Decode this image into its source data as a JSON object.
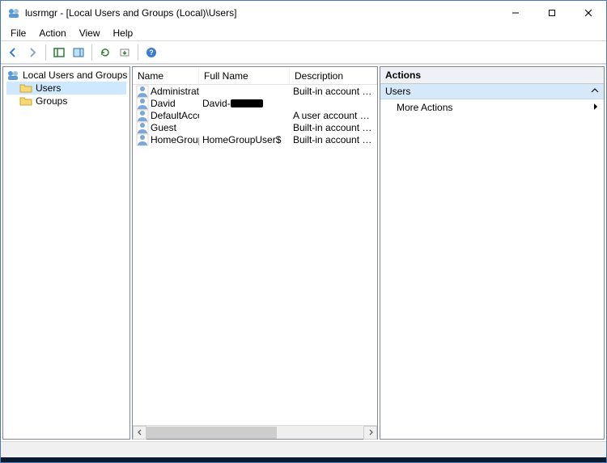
{
  "window": {
    "title": "lusrmgr - [Local Users and Groups (Local)\\Users]"
  },
  "menu": {
    "items": [
      "File",
      "Action",
      "View",
      "Help"
    ]
  },
  "toolbar": {
    "back": "back-icon",
    "forward": "forward-icon",
    "up": "up-icon",
    "show_hide_tree": "tree-icon",
    "props": "props-icon",
    "refresh": "refresh-icon",
    "export": "export-icon",
    "help": "help-icon"
  },
  "tree": {
    "root": "Local Users and Groups (Local)",
    "nodes": [
      {
        "label": "Users",
        "selected": true
      },
      {
        "label": "Groups",
        "selected": false
      }
    ]
  },
  "list": {
    "columns": {
      "name": "Name",
      "full_name": "Full Name",
      "description": "Description"
    },
    "rows": [
      {
        "name": "Administrator",
        "full_name": "",
        "description": "Built-in account for adm"
      },
      {
        "name": "David",
        "full_name": "David-",
        "full_redacted": true,
        "description": ""
      },
      {
        "name": "DefaultAcco...",
        "full_name": "",
        "description": "A user account manage"
      },
      {
        "name": "Guest",
        "full_name": "",
        "description": "Built-in account for gue"
      },
      {
        "name": "HomeGroup...",
        "full_name": "HomeGroupUser$",
        "description": "Built-in account for hon"
      }
    ]
  },
  "actions": {
    "header": "Actions",
    "section": "Users",
    "items": [
      "More Actions"
    ]
  }
}
